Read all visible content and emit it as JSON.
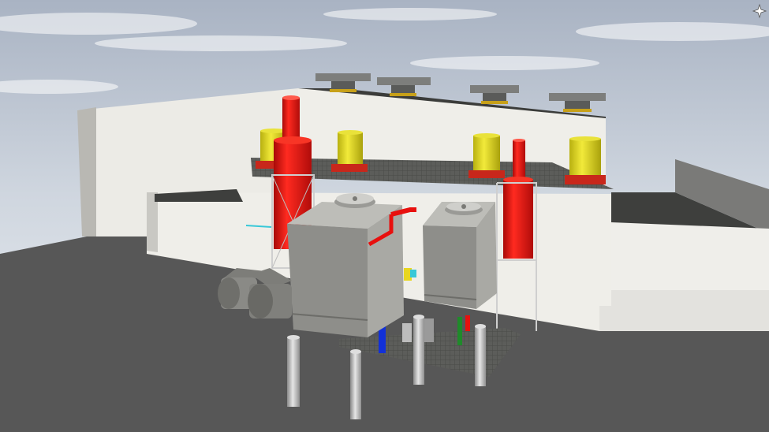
{
  "scene": {
    "description_free": true,
    "colors": {
      "sky_top": "#a9b3c3",
      "sky_bottom": "#e8ecf1",
      "ground": "#575757",
      "wall_light": "#ecebe6",
      "wall_shadow": "#a9a8a3",
      "roof_dark": "#3f403e",
      "stack_red": "#e8100e",
      "fan_yellow": "#dcd422",
      "equipment_gray": "#8e8e8a",
      "pipe_blue": "#1230d8",
      "pipe_gray": "#c8c8c8"
    },
    "icons": {
      "compass": "compass-icon"
    }
  }
}
